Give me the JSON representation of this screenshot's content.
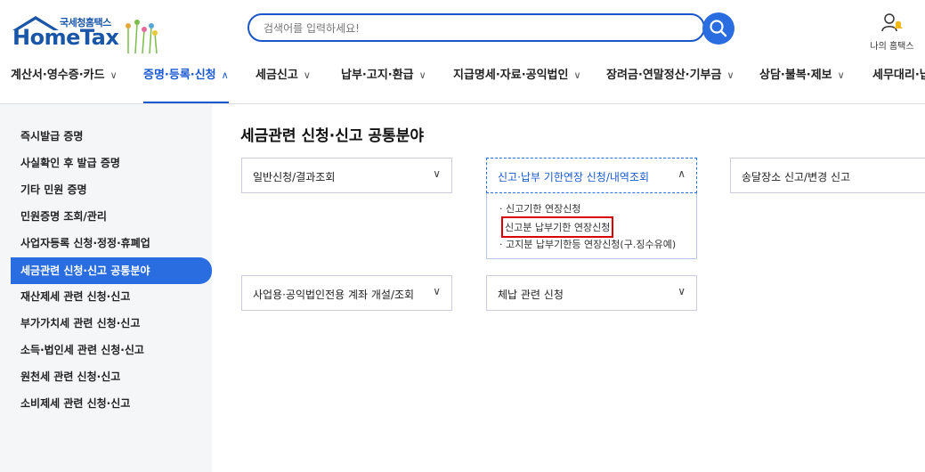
{
  "header": {
    "logo_small": "국세청홈택스",
    "logo_big": "HomeTax",
    "search_placeholder": "검색어를 입력하세요!",
    "my_hometax": "나의 홈택스"
  },
  "nav": [
    {
      "label": "계산서·영수증·카드",
      "active": false
    },
    {
      "label": "증명·등록·신청",
      "active": true
    },
    {
      "label": "세금신고",
      "active": false
    },
    {
      "label": "납부·고지·환급",
      "active": false
    },
    {
      "label": "지급명세·자료·공익법인",
      "active": false
    },
    {
      "label": "장려금·연말정산·기부금",
      "active": false
    },
    {
      "label": "상담·불복·제보",
      "active": false
    },
    {
      "label": "세무대리·납",
      "active": false
    }
  ],
  "sidebar": {
    "items": [
      {
        "label": "즉시발급 증명"
      },
      {
        "label": "사실확인 후 발급 증명"
      },
      {
        "label": "기타 민원 증명"
      },
      {
        "label": "민원증명 조회/관리"
      },
      {
        "label": "사업자등록 신청·정정·휴폐업"
      },
      {
        "label": "세금관련 신청·신고 공통분야"
      },
      {
        "label": "재산제세 관련 신청·신고"
      },
      {
        "label": "부가가치세 관련 신청·신고"
      },
      {
        "label": "소득·법인세 관련 신청·신고"
      },
      {
        "label": "원천세 관련 신청·신고"
      },
      {
        "label": "소비제세 관련 신청·신고"
      }
    ],
    "active_index": 5
  },
  "main": {
    "title": "세금관련 신청·신고 공통분야",
    "cards": [
      {
        "label": "일반신청/결과조회"
      },
      {
        "label": "신고·납부 기한연장 신청/내역조회"
      },
      {
        "label": "송달장소 신고/변경 신고"
      },
      {
        "label": "사업용·공익법인전용 계좌 개설/조회"
      },
      {
        "label": "체납 관련 신청"
      }
    ],
    "dropdown": [
      {
        "label": "신고기한 연장신청"
      },
      {
        "label": "신고분 납부기한 연장신청"
      },
      {
        "label": "고지분 납부기한등 연장신청(구.징수유예)"
      }
    ]
  },
  "colors": {
    "accent": "#2a6de0",
    "highlight_box": "#dd0000"
  }
}
